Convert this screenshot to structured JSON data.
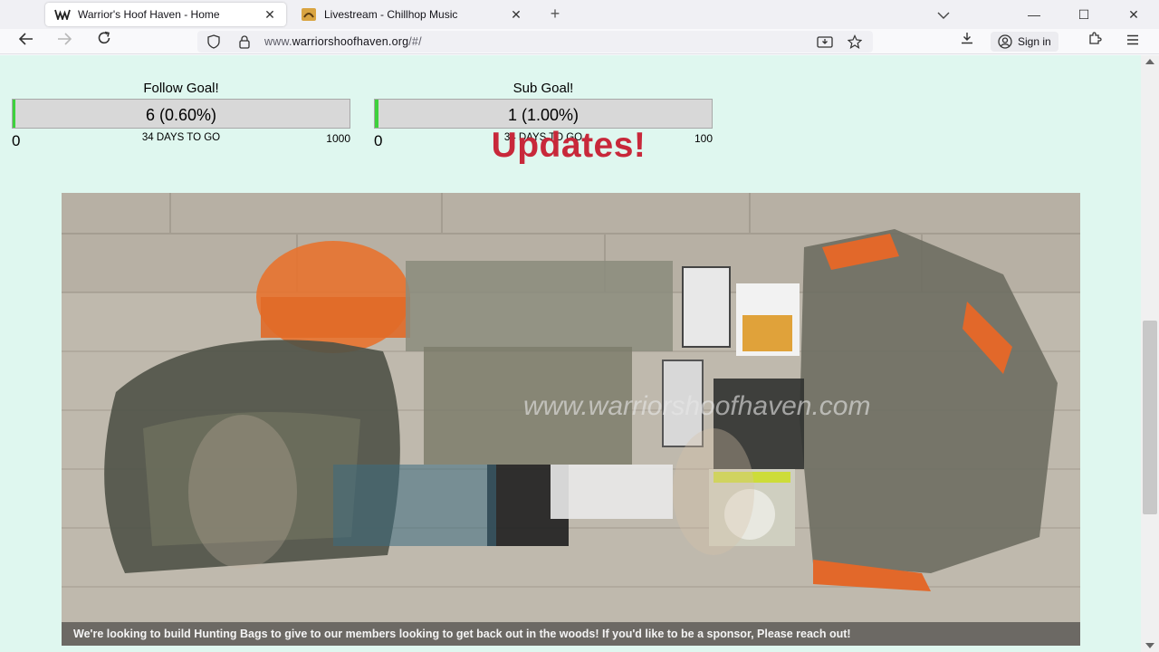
{
  "tabs": [
    {
      "title": "Warrior's Hoof Haven - Home",
      "icon": "ww-logo-icon",
      "active": true
    },
    {
      "title": "Livestream - Chillhop Music",
      "icon": "chillhop-logo-icon",
      "active": false
    }
  ],
  "nav": {
    "url_prefix": "www.",
    "url_domain": "warriorshoofhaven.org",
    "url_suffix": "/#/",
    "signin_label": "Sign in"
  },
  "goals": {
    "follow": {
      "title": "Follow Goal!",
      "value_text": "6 (0.60%)",
      "min": "0",
      "max": "1000",
      "days": "34 DAYS TO GO",
      "progress": 0.006
    },
    "sub": {
      "title": "Sub Goal!",
      "value_text": "1 (1.00%)",
      "min": "0",
      "max": "100",
      "days": "34 DAYS TO GO",
      "progress": 0.01
    }
  },
  "updates_heading": "Updates!",
  "slide": {
    "caption": "We're looking to build Hunting Bags to give to our members looking to get back out in the woods! If you'd like to be a sponsor, Please reach out!",
    "image_text": "www.warriorshoofhaven.com"
  },
  "colors": {
    "accent_red": "#c8283a",
    "page_bg": "#dff7ef",
    "progress_green": "#3dd13d"
  }
}
